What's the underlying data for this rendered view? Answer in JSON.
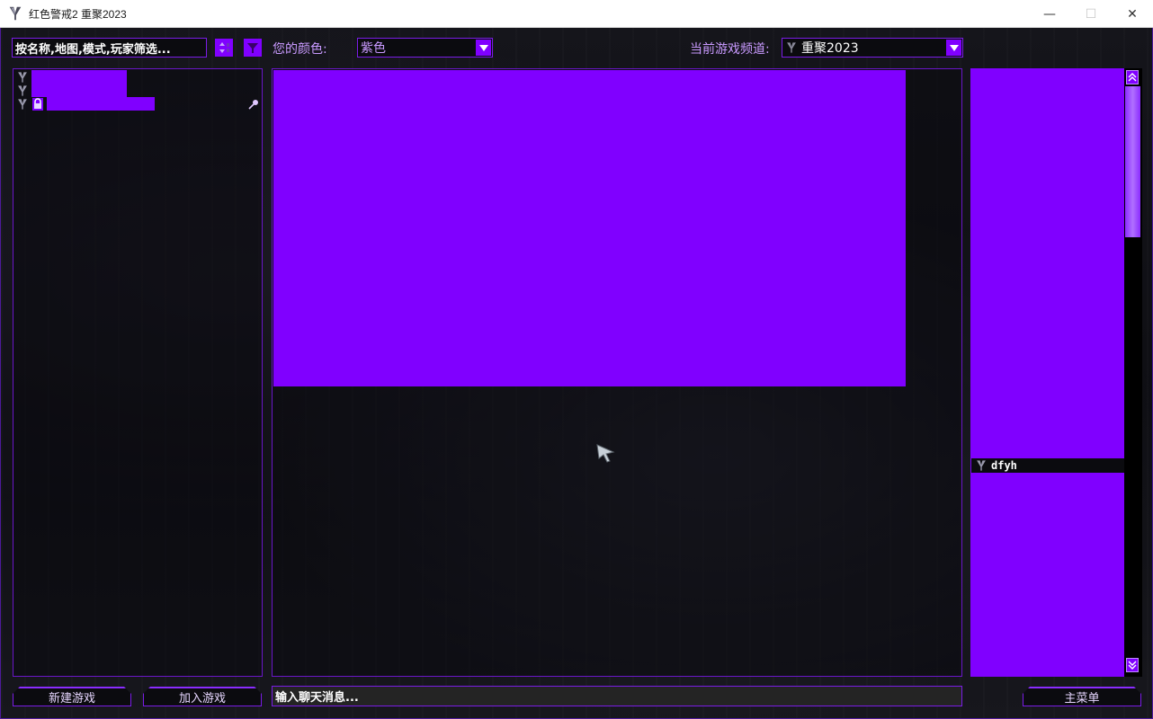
{
  "window": {
    "title": "红色警戒2 重聚2023",
    "controls": {
      "minimize": "—",
      "maximize": "☐",
      "close": "✕"
    }
  },
  "toolbar": {
    "filter_text": "按名称,地图,模式,玩家筛选...",
    "sort_icon": "sort-icon",
    "filter_icon": "funnel-icon",
    "color_label": "您的颜色:",
    "color_value": "紫色",
    "channel_label": "当前游戏频道:",
    "channel_value": "重聚2023"
  },
  "players": [
    {
      "name": "dfyh"
    }
  ],
  "buttons": {
    "new_game": "新建游戏",
    "join_game": "加入游戏",
    "main_menu": "主菜单"
  },
  "chat": {
    "placeholder": "输入聊天消息..."
  },
  "colors": {
    "accent": "#8000ff",
    "border": "#7a1ce6",
    "label": "#c99aff",
    "background": "#0e0e13"
  }
}
